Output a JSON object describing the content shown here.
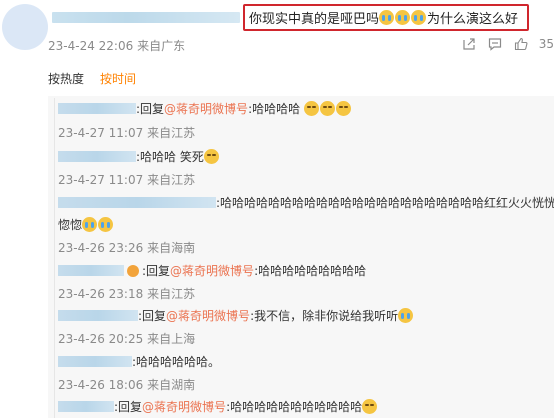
{
  "comment": {
    "text_prefix": "你现实中真的是哑巴吗",
    "text_suffix": "为什么演这么好",
    "time": "23-4-24 22:06",
    "location": "来自广东",
    "like_count": "35"
  },
  "tabs": [
    "按热度",
    "按时间"
  ],
  "replies": [
    {
      "pre": ":回复",
      "mention": "@蒋奇明微博号",
      "text": ":哈哈哈哈",
      "time": "23-4-27 11:07",
      "location": "来自江苏"
    },
    {
      "text": ":哈哈哈 笑死",
      "time": "23-4-27 11:07",
      "location": "来自江苏"
    },
    {
      "text": ":哈哈哈哈哈哈哈哈哈哈哈哈哈哈哈哈哈哈哈哈哈哈红红火火恍恍",
      "text2": "惚惚",
      "time": "23-4-26 23:26",
      "location": "来自海南"
    },
    {
      "pre": ":回复",
      "mention": "@蒋奇明微博号",
      "text": ":哈哈哈哈哈哈哈哈哈",
      "time": "23-4-26 23:18",
      "location": "来自江苏"
    },
    {
      "pre": ":回复",
      "mention": "@蒋奇明微博号",
      "text": ":我不信，除非你说给我听听",
      "time": "23-4-26 20:25",
      "location": "来自上海"
    },
    {
      "text": ":哈哈哈哈哈哈。",
      "time": "23-4-26 18:06",
      "location": "来自湖南"
    },
    {
      "pre": ":回复",
      "mention": "@蒋奇明微博号",
      "text": ":哈哈哈哈哈哈哈哈哈哈哈"
    }
  ]
}
